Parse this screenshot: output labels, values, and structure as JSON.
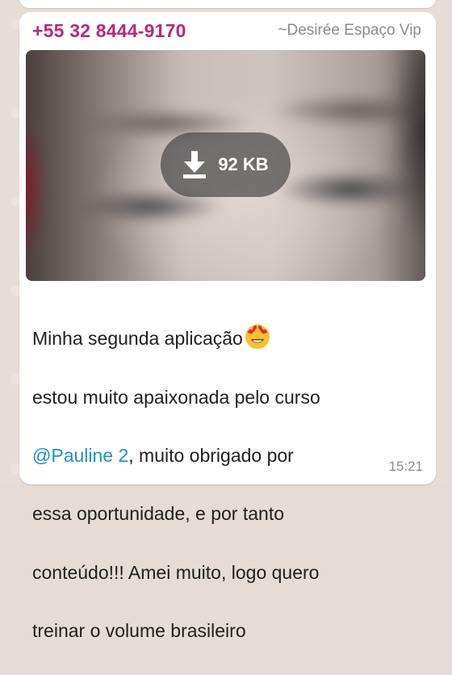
{
  "message": {
    "sender_phone": "+55 32 8444-9170",
    "sender_name": "~Desirée Espaço Vip",
    "media": {
      "download_size": "92 KB",
      "download_icon": "download-arrow-icon"
    },
    "text": {
      "line1": "Minha segunda aplicação",
      "emoji": "heart-eyes-emoji",
      "line2": "estou muito apaixonada pelo curso",
      "mention": "@Pauline 2",
      "line3_rest": ", muito obrigado por",
      "line4": "essa oportunidade, e por tanto",
      "line5": "conteúdo!!! Amei muito, logo quero",
      "line6": "treinar o volume brasileiro"
    },
    "time": "15:21"
  },
  "colors": {
    "sender": "#b8287f",
    "mention": "#1f8fce",
    "bubble": "#ffffff",
    "chat_background": "#e5ddd5"
  }
}
